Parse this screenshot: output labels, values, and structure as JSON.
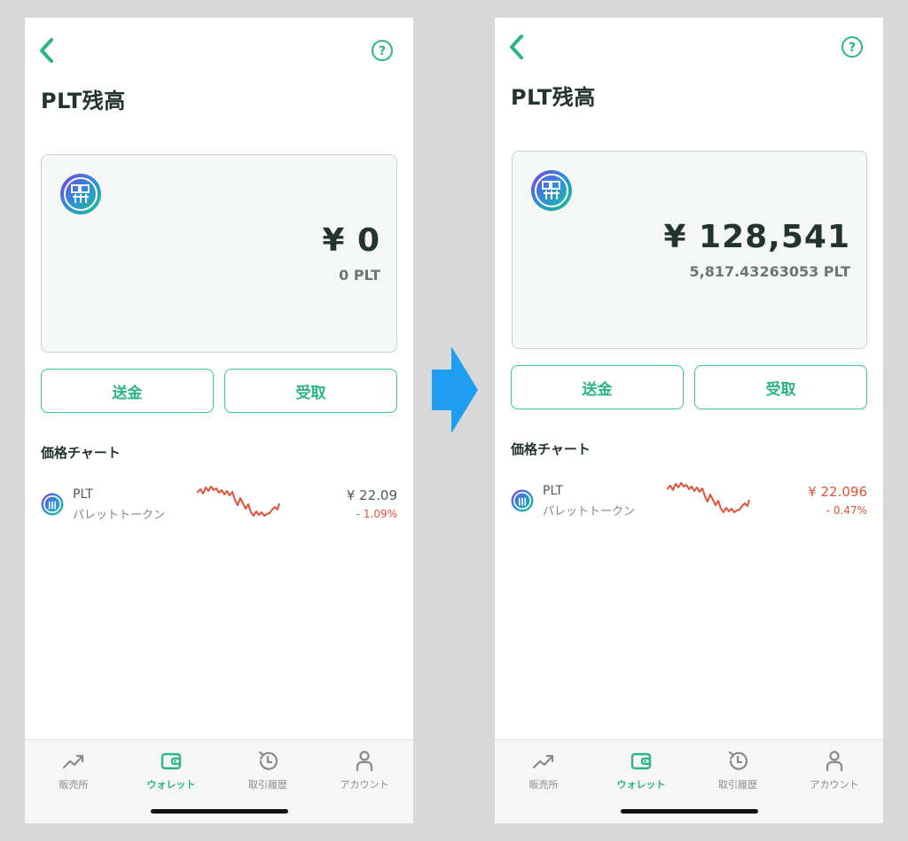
{
  "colors": {
    "accent": "#2bb585",
    "negative": "#e0523a",
    "arrow": "#1f9df0"
  },
  "screens": [
    {
      "title": "PLT残高",
      "balance": {
        "yen": "¥ 0",
        "plt": "0 PLT"
      },
      "actions": {
        "send": "送金",
        "receive": "受取"
      },
      "section_title": "価格チャート",
      "chart_row": {
        "symbol": "PLT",
        "name": "パレットトークン",
        "price": "¥ 22.09",
        "change": "- 1.09%"
      },
      "tabs": [
        "販売所",
        "ウォレット",
        "取引履歴",
        "アカウント"
      ],
      "active_tab": "ウォレット"
    },
    {
      "title": "PLT残高",
      "balance": {
        "yen": "¥ 128,541",
        "plt": "5,817.43263053 PLT"
      },
      "actions": {
        "send": "送金",
        "receive": "受取"
      },
      "section_title": "価格チャート",
      "chart_row": {
        "symbol": "PLT",
        "name": "パレットトークン",
        "price": "¥ 22.096",
        "change": "- 0.47%"
      },
      "tabs": [
        "販売所",
        "ウォレット",
        "取引履歴",
        "アカウント"
      ],
      "active_tab": "ウォレット"
    }
  ],
  "icons": {
    "back": "chevron-left-icon",
    "help": "question-circle-icon",
    "token": "plt-token-logo",
    "transition": "arrow-right-icon",
    "tab_icons": [
      "trend-chart-icon",
      "wallet-icon",
      "history-icon",
      "person-icon"
    ]
  }
}
